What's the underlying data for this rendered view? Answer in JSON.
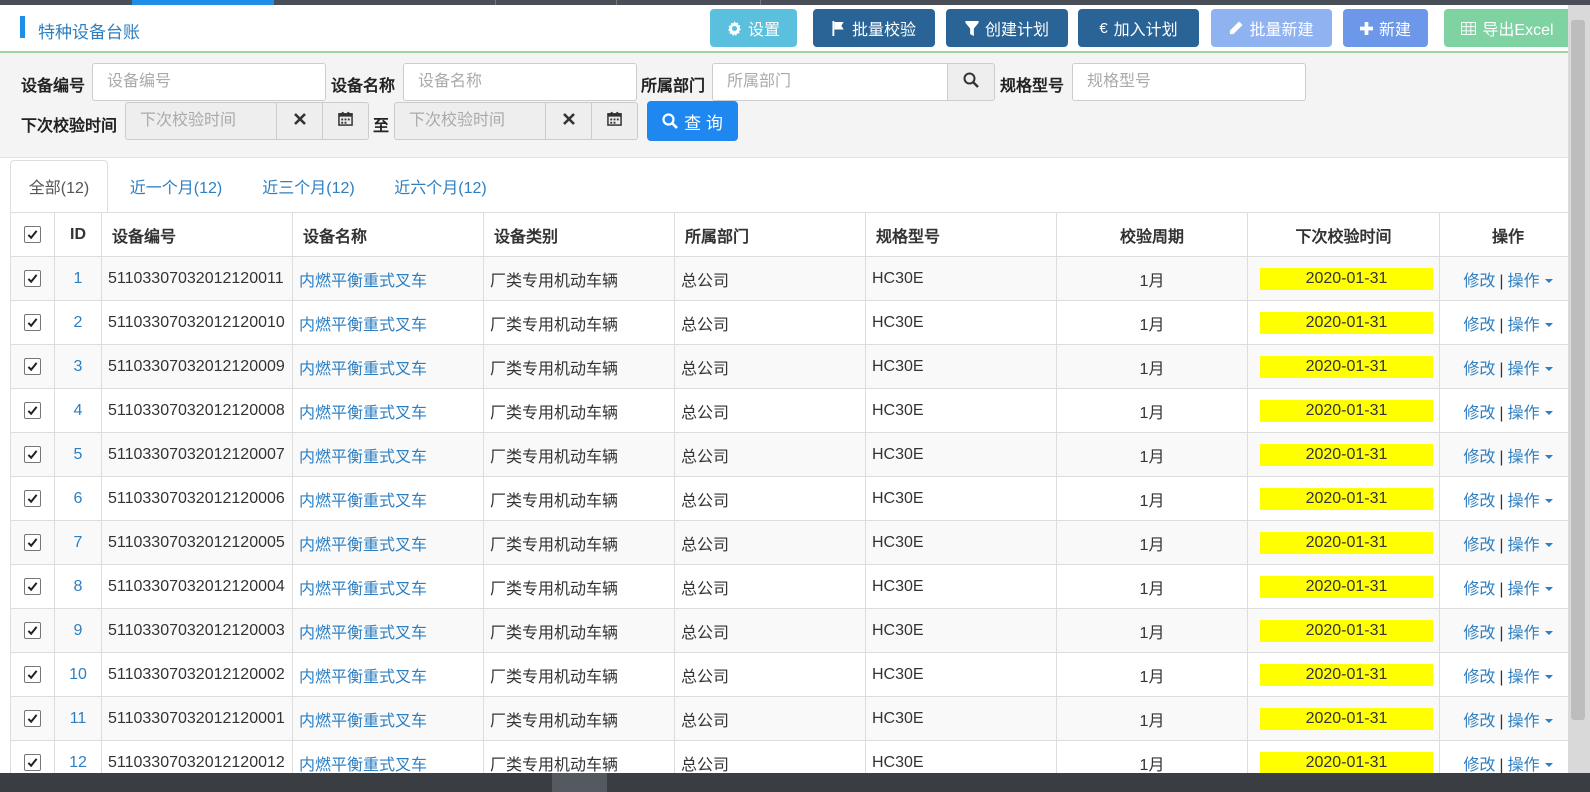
{
  "header": {
    "title": "特种设备台账",
    "buttons": {
      "settings": "设置",
      "batch_check": "批量校验",
      "create_plan": "创建计划",
      "add_plan": "加入计划",
      "batch_new": "批量新建",
      "new": "新建",
      "export": "导出Excel"
    }
  },
  "search": {
    "device_no_label": "设备编号",
    "device_no_placeholder": "设备编号",
    "device_name_label": "设备名称",
    "device_name_placeholder": "设备名称",
    "dept_label": "所属部门",
    "dept_placeholder": "所属部门",
    "spec_label": "规格型号",
    "spec_placeholder": "规格型号",
    "next_check_label": "下次校验时间",
    "next_check_from_placeholder": "下次校验时间",
    "to_label": "至",
    "next_check_to_placeholder": "下次校验时间",
    "query_label": "查 询"
  },
  "tabs": [
    {
      "label": "全部(12)"
    },
    {
      "label": "近一个月(12)"
    },
    {
      "label": "近三个月(12)"
    },
    {
      "label": "近六个月(12)"
    }
  ],
  "table": {
    "headers": {
      "id": "ID",
      "device_no": "设备编号",
      "device_name": "设备名称",
      "category": "设备类别",
      "dept": "所属部门",
      "spec": "规格型号",
      "cycle": "校验周期",
      "next_check": "下次校验时间",
      "actions": "操作"
    },
    "rows": [
      {
        "id": "1",
        "device_no": "51103307032012120011",
        "device_name": "内燃平衡重式叉车",
        "category": "厂类专用机动车辆",
        "dept": "总公司",
        "spec": "HC30E",
        "cycle": "1月",
        "next_check": "2020-01-31"
      },
      {
        "id": "2",
        "device_no": "51103307032012120010",
        "device_name": "内燃平衡重式叉车",
        "category": "厂类专用机动车辆",
        "dept": "总公司",
        "spec": "HC30E",
        "cycle": "1月",
        "next_check": "2020-01-31"
      },
      {
        "id": "3",
        "device_no": "51103307032012120009",
        "device_name": "内燃平衡重式叉车",
        "category": "厂类专用机动车辆",
        "dept": "总公司",
        "spec": "HC30E",
        "cycle": "1月",
        "next_check": "2020-01-31"
      },
      {
        "id": "4",
        "device_no": "51103307032012120008",
        "device_name": "内燃平衡重式叉车",
        "category": "厂类专用机动车辆",
        "dept": "总公司",
        "spec": "HC30E",
        "cycle": "1月",
        "next_check": "2020-01-31"
      },
      {
        "id": "5",
        "device_no": "51103307032012120007",
        "device_name": "内燃平衡重式叉车",
        "category": "厂类专用机动车辆",
        "dept": "总公司",
        "spec": "HC30E",
        "cycle": "1月",
        "next_check": "2020-01-31"
      },
      {
        "id": "6",
        "device_no": "51103307032012120006",
        "device_name": "内燃平衡重式叉车",
        "category": "厂类专用机动车辆",
        "dept": "总公司",
        "spec": "HC30E",
        "cycle": "1月",
        "next_check": "2020-01-31"
      },
      {
        "id": "7",
        "device_no": "51103307032012120005",
        "device_name": "内燃平衡重式叉车",
        "category": "厂类专用机动车辆",
        "dept": "总公司",
        "spec": "HC30E",
        "cycle": "1月",
        "next_check": "2020-01-31"
      },
      {
        "id": "8",
        "device_no": "51103307032012120004",
        "device_name": "内燃平衡重式叉车",
        "category": "厂类专用机动车辆",
        "dept": "总公司",
        "spec": "HC30E",
        "cycle": "1月",
        "next_check": "2020-01-31"
      },
      {
        "id": "9",
        "device_no": "51103307032012120003",
        "device_name": "内燃平衡重式叉车",
        "category": "厂类专用机动车辆",
        "dept": "总公司",
        "spec": "HC30E",
        "cycle": "1月",
        "next_check": "2020-01-31"
      },
      {
        "id": "10",
        "device_no": "51103307032012120002",
        "device_name": "内燃平衡重式叉车",
        "category": "厂类专用机动车辆",
        "dept": "总公司",
        "spec": "HC30E",
        "cycle": "1月",
        "next_check": "2020-01-31"
      },
      {
        "id": "11",
        "device_no": "51103307032012120001",
        "device_name": "内燃平衡重式叉车",
        "category": "厂类专用机动车辆",
        "dept": "总公司",
        "spec": "HC30E",
        "cycle": "1月",
        "next_check": "2020-01-31"
      },
      {
        "id": "12",
        "device_no": "51103307032012120012",
        "device_name": "内燃平衡重式叉车",
        "category": "厂类专用机动车辆",
        "dept": "总公司",
        "spec": "HC30E",
        "cycle": "1月",
        "next_check": "2020-01-31"
      }
    ],
    "row_actions": {
      "edit": "修改",
      "separator": "|",
      "more": "操作"
    }
  },
  "colors": {
    "primary": "#1e88f0",
    "dark_button": "#2a6496",
    "info_button": "#5bc0de",
    "export_button": "#7fd2a2",
    "date_highlight": "#ffff00",
    "link": "#2d7fc2"
  }
}
